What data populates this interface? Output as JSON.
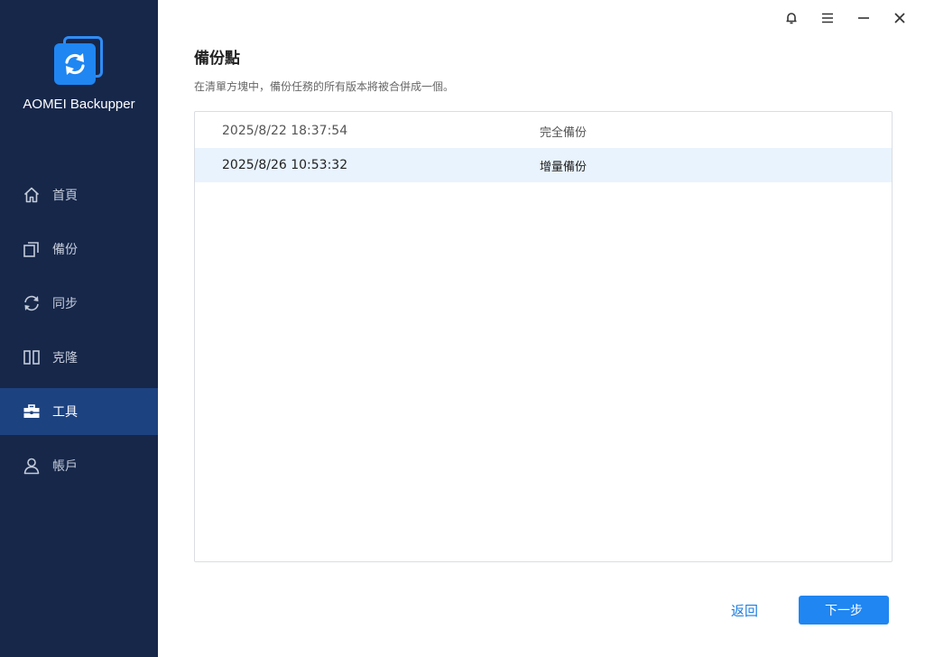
{
  "app": {
    "name": "AOMEI Backupper",
    "accent_color": "#1f86f2",
    "sidebar_color": "#16274a",
    "active_color": "#1d4280"
  },
  "sidebar": {
    "items": [
      {
        "label": "首頁",
        "icon": "home-icon",
        "active": false
      },
      {
        "label": "備份",
        "icon": "backup-icon",
        "active": false
      },
      {
        "label": "同步",
        "icon": "sync-icon",
        "active": false
      },
      {
        "label": "克隆",
        "icon": "clone-icon",
        "active": false
      },
      {
        "label": "工具",
        "icon": "toolbox-icon",
        "active": true
      },
      {
        "label": "帳戶",
        "icon": "user-icon",
        "active": false
      }
    ]
  },
  "titlebar": {
    "icons": [
      "bell-icon",
      "menu-icon",
      "minimize-icon",
      "close-icon"
    ]
  },
  "page": {
    "title": "備份點",
    "description": "在清單方塊中，備份任務的所有版本將被合併成一個。"
  },
  "backup_points": [
    {
      "time": "2025/8/22 18:37:54",
      "type": "完全備份",
      "selected": false
    },
    {
      "time": "2025/8/26 10:53:32",
      "type": "增量備份",
      "selected": true
    }
  ],
  "buttons": {
    "back": "返回",
    "next": "下一步"
  }
}
